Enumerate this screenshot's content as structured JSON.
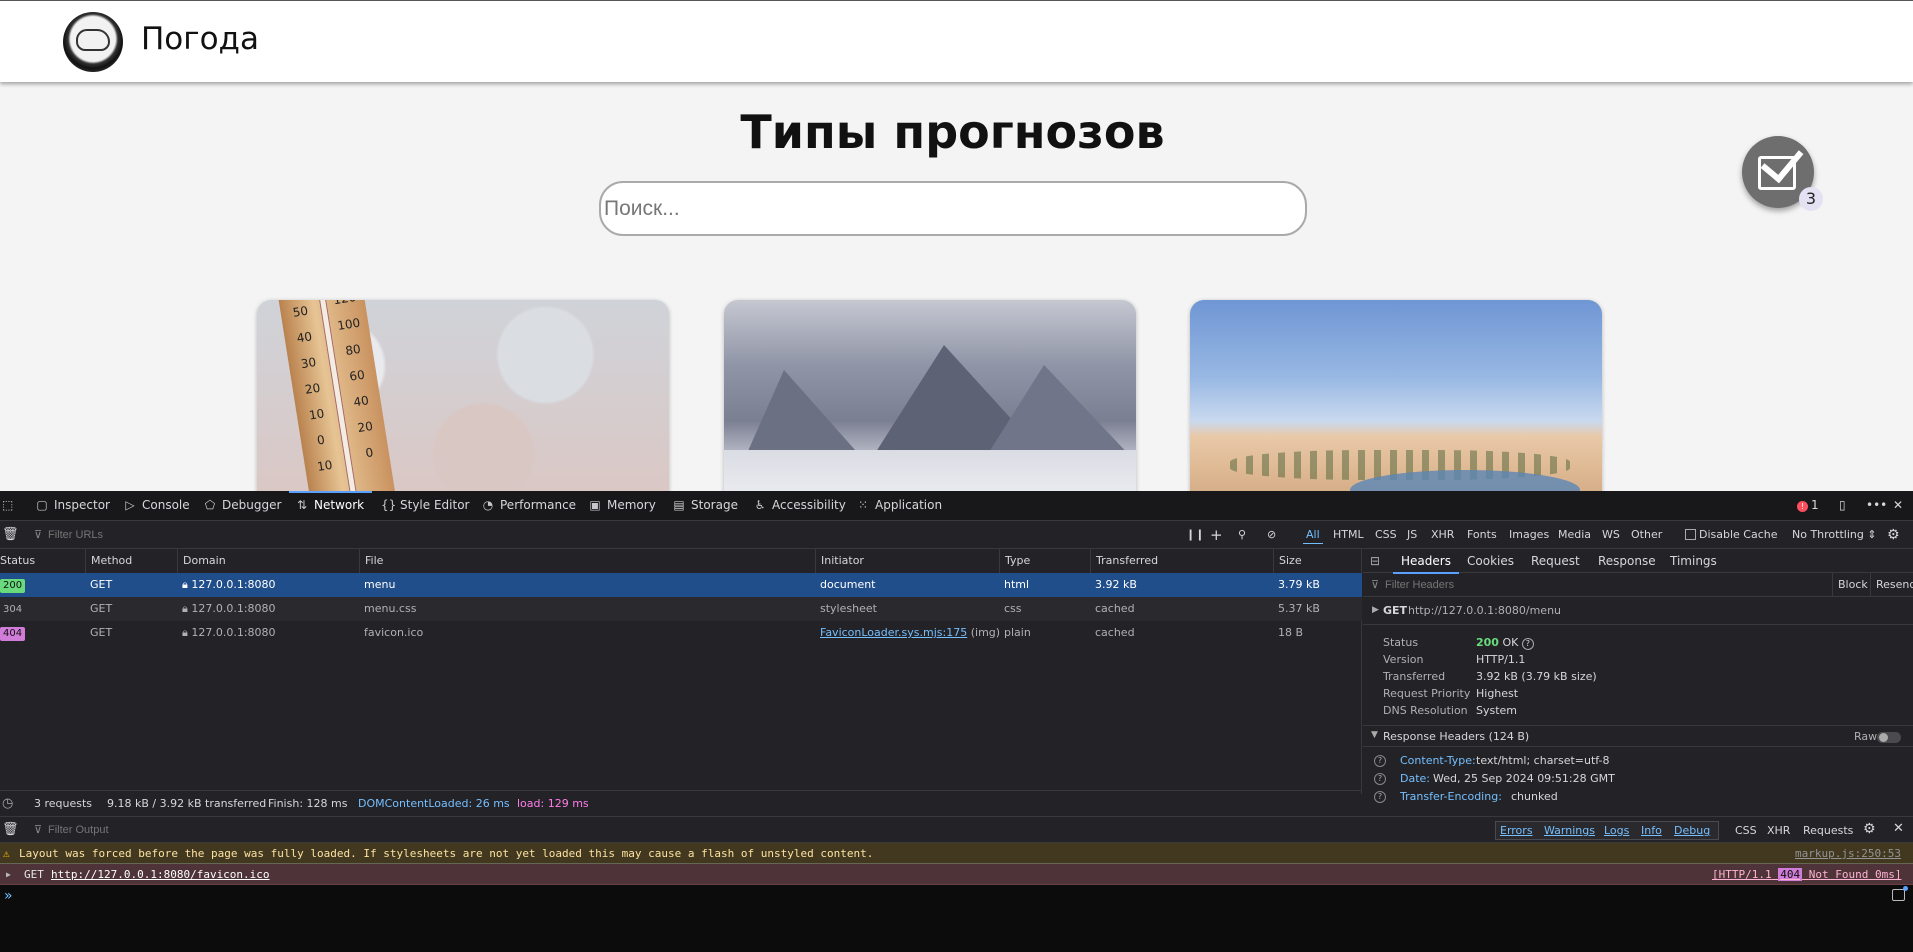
{
  "site": {
    "title": "Погода",
    "heading": "Типы прогнозов",
    "search_placeholder": "Поиск...",
    "check_count": "3",
    "cards": [
      {
        "image": "thermometer-photo",
        "labels": [
          "50",
          "120",
          "40",
          "100",
          "30",
          "80",
          "20",
          "60",
          "10",
          "40",
          "0",
          "20",
          "10",
          "0"
        ]
      },
      {
        "image": "mountains-photo"
      },
      {
        "image": "desert-oasis-photo"
      }
    ]
  },
  "devtools": {
    "tabs": [
      {
        "label": "Inspector",
        "icon": "inspector-icon"
      },
      {
        "label": "Console",
        "icon": "console-icon"
      },
      {
        "label": "Debugger",
        "icon": "debugger-icon"
      },
      {
        "label": "Network",
        "icon": "network-icon"
      },
      {
        "label": "Style Editor",
        "icon": "style-editor-icon"
      },
      {
        "label": "Performance",
        "icon": "performance-icon"
      },
      {
        "label": "Memory",
        "icon": "memory-icon"
      },
      {
        "label": "Storage",
        "icon": "storage-icon"
      },
      {
        "label": "Accessibility",
        "icon": "accessibility-icon"
      },
      {
        "label": "Application",
        "icon": "application-icon"
      }
    ],
    "active_tab": "Network",
    "error_count": "1",
    "network": {
      "filter_placeholder": "Filter URLs",
      "type_filters": [
        "All",
        "HTML",
        "CSS",
        "JS",
        "XHR",
        "Fonts",
        "Images",
        "Media",
        "WS",
        "Other"
      ],
      "active_type_filter": "All",
      "disable_cache_label": "Disable Cache",
      "throttling_label": "No Throttling",
      "columns": [
        "Status",
        "Method",
        "Domain",
        "File",
        "Initiator",
        "Type",
        "Transferred",
        "Size"
      ],
      "rows": [
        {
          "status": "200",
          "method": "GET",
          "domain": "127.0.0.1:8080",
          "file": "menu",
          "initiator": "document",
          "initiator_extra": "",
          "type": "html",
          "transferred": "3.92 kB",
          "size": "3.79 kB"
        },
        {
          "status": "304",
          "method": "GET",
          "domain": "127.0.0.1:8080",
          "file": "menu.css",
          "initiator": "stylesheet",
          "initiator_extra": "",
          "type": "css",
          "transferred": "cached",
          "size": "5.37 kB"
        },
        {
          "status": "404",
          "method": "GET",
          "domain": "127.0.0.1:8080",
          "file": "favicon.ico",
          "initiator": "FaviconLoader.sys.mjs:175",
          "initiator_extra": "(img)",
          "type": "plain",
          "transferred": "cached",
          "size": "18 B"
        }
      ],
      "summary": {
        "requests": "3 requests",
        "transferred": "9.18 kB / 3.92 kB transferred",
        "finish": "Finish: 128 ms",
        "dom_loaded": "DOMContentLoaded: 26 ms",
        "load": "load: 129 ms"
      }
    },
    "details": {
      "tabs": [
        "Headers",
        "Cookies",
        "Request",
        "Response",
        "Timings"
      ],
      "active_tab": "Headers",
      "filter_placeholder": "Filter Headers",
      "block_label": "Block",
      "resend_label": "Resend",
      "request_line": {
        "method": "GET",
        "url": "http://127.0.0.1:8080/menu"
      },
      "status_code": "200",
      "status_text": "OK",
      "fields": [
        {
          "key": "Status",
          "value": ""
        },
        {
          "key": "Version",
          "value": "HTTP/1.1"
        },
        {
          "key": "Transferred",
          "value": "3.92 kB (3.79 kB size)"
        },
        {
          "key": "Request Priority",
          "value": "Highest"
        },
        {
          "key": "DNS Resolution",
          "value": "System"
        }
      ],
      "response_headers_title": "Response Headers (124 B)",
      "raw_label": "Raw",
      "response_headers": [
        {
          "key": "Content-Type:",
          "value": "text/html; charset=utf-8"
        },
        {
          "key": "Date:",
          "value": "Wed, 25 Sep 2024 09:51:28 GMT"
        },
        {
          "key": "Transfer-Encoding:",
          "value": "chunked"
        }
      ]
    },
    "console": {
      "filter_placeholder": "Filter Output",
      "levels": [
        "Errors",
        "Warnings",
        "Logs",
        "Info",
        "Debug"
      ],
      "extra_filters": [
        "CSS",
        "XHR",
        "Requests"
      ],
      "warning": {
        "text": "Layout was forced before the page was fully loaded. If stylesheets are not yet loaded this may cause a flash of unstyled content.",
        "source": "markup.js:250:53"
      },
      "error": {
        "method": "GET",
        "url": "http://127.0.0.1:8080/favicon.ico",
        "result_prefix": "[HTTP/1.1",
        "result_code": "404",
        "result_suffix": "Not Found 0ms]"
      }
    }
  },
  "colors": {
    "accent": "#5aa0ff",
    "status_200": "#69db7c",
    "status_304": "#b1b1b3",
    "status_404": "#d07cd9",
    "selected_row": "#204e8a"
  }
}
